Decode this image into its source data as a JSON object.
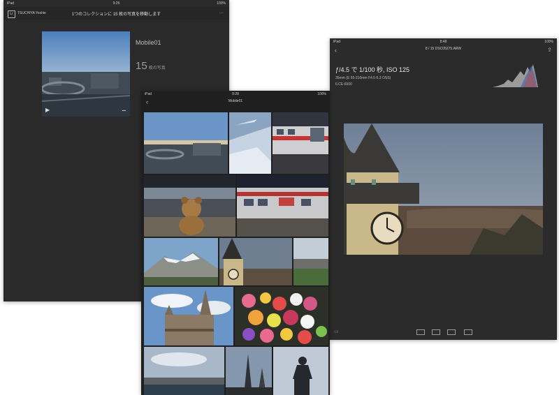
{
  "statusbar": {
    "carrier": "iPad",
    "time_left": "9:25",
    "time_center": "9:28",
    "time_right": "8:48",
    "battery": "100%"
  },
  "collection_screen": {
    "app_name": "TSUCHIYA Yoshie",
    "header": "1つのコレクションに 15 枚の写真を移動します",
    "collection_name": "Mobile01",
    "photo_count": "15",
    "photo_unit": "枚の写真"
  },
  "grid_screen": {
    "collection_title": "Mobile01"
  },
  "detail_screen": {
    "nav_title": "8 / 15  DSC05275.ARW",
    "exif_line1": "ƒ/4.5 で 1/100 秒, ISO 125",
    "exif_line2": "35mm (E 55-210mm F4.5-6.3 OSS)",
    "exif_line3": "ILCE-6000"
  },
  "icons": {
    "back": "chevron-left-icon",
    "share": "share-icon",
    "menu": "more-icon",
    "play": "play-icon"
  },
  "colors": {
    "app_background": "#2a2a2a",
    "page_background": "#ffffff"
  }
}
